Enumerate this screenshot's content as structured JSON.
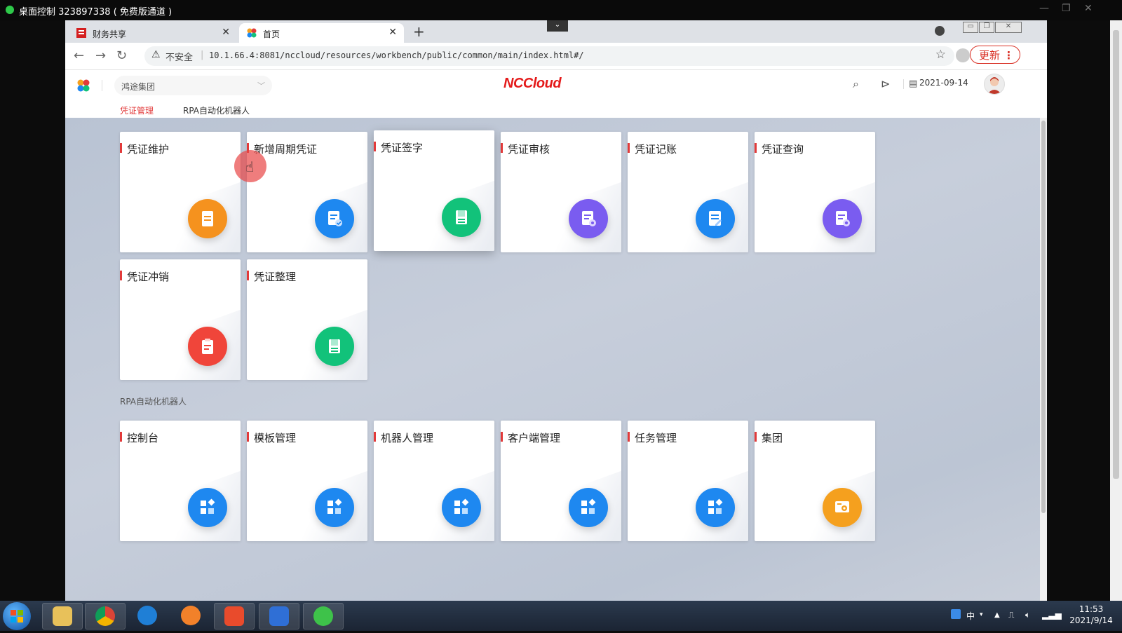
{
  "remote_bar": {
    "title": "桌面控制 323897338 ( 免费版通道 )"
  },
  "browser": {
    "tabs": [
      {
        "label": "财务共享",
        "active": false
      },
      {
        "label": "首页",
        "active": true
      }
    ],
    "new_tab": "+",
    "address": {
      "security": "不安全",
      "url": "10.1.66.4:8081/nccloud/resources/workbench/public/common/main/index.html#/"
    },
    "update_label": "更新"
  },
  "app": {
    "org_select": "鸿途集团",
    "brand": "NCCloud",
    "date": "2021-09-14",
    "subtabs": [
      {
        "label": "凭证管理",
        "active": true
      },
      {
        "label": "RPA自动化机器人",
        "active": false
      }
    ],
    "voucher_cards": [
      {
        "title": "凭证维护",
        "icon": "document-icon",
        "color": "#f5921e"
      },
      {
        "title": "新增周期凭证",
        "icon": "document-check-icon",
        "color": "#1e88f0"
      },
      {
        "title": "凭证签字",
        "icon": "document-sign-icon",
        "color": "#12c27a"
      },
      {
        "title": "凭证审核",
        "icon": "document-audit-icon",
        "color": "#7a5cf0"
      },
      {
        "title": "凭证记账",
        "icon": "document-edit-icon",
        "color": "#1e88f0"
      },
      {
        "title": "凭证查询",
        "icon": "document-search-icon",
        "color": "#7a5cf0"
      },
      {
        "title": "凭证冲销",
        "icon": "clipboard-icon",
        "color": "#f0453a"
      },
      {
        "title": "凭证整理",
        "icon": "document-sign-icon",
        "color": "#12c27a"
      }
    ],
    "rpa_section_label": "RPA自动化机器人",
    "rpa_cards": [
      {
        "title": "控制台",
        "icon": "apps-icon",
        "color": "#1e88f0"
      },
      {
        "title": "模板管理",
        "icon": "apps-icon",
        "color": "#1e88f0"
      },
      {
        "title": "机器人管理",
        "icon": "apps-icon",
        "color": "#1e88f0"
      },
      {
        "title": "客户端管理",
        "icon": "apps-icon",
        "color": "#1e88f0"
      },
      {
        "title": "任务管理",
        "icon": "apps-icon",
        "color": "#1e88f0"
      },
      {
        "title": "集团",
        "icon": "org-settings-icon",
        "color": "#f5a01e"
      }
    ]
  },
  "taskbar": {
    "ime": "中",
    "time": "11:53",
    "date": "2021/9/14"
  }
}
